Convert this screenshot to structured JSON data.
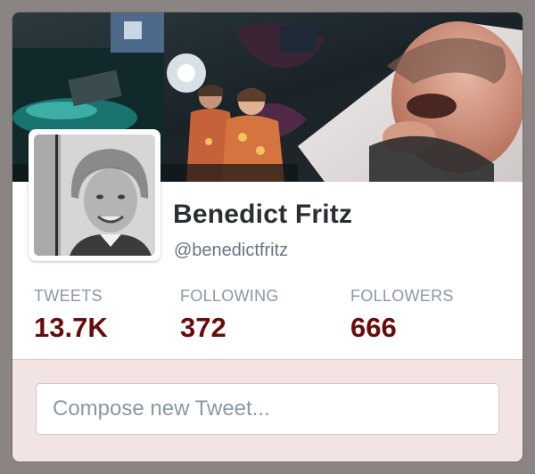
{
  "profile": {
    "name": "Benedict Fritz",
    "handle": "@benedictfritz"
  },
  "stats": [
    {
      "label": "TWEETS",
      "value": "13.7K"
    },
    {
      "label": "FOLLOWING",
      "value": "372"
    },
    {
      "label": "FOLLOWERS",
      "value": "666"
    }
  ],
  "compose": {
    "placeholder": "Compose new Tweet..."
  },
  "colors": {
    "stat_value": "#6a0b0b",
    "stat_label": "#8899a6",
    "compose_background": "#f3e4e4",
    "page_background": "#8a8583"
  }
}
